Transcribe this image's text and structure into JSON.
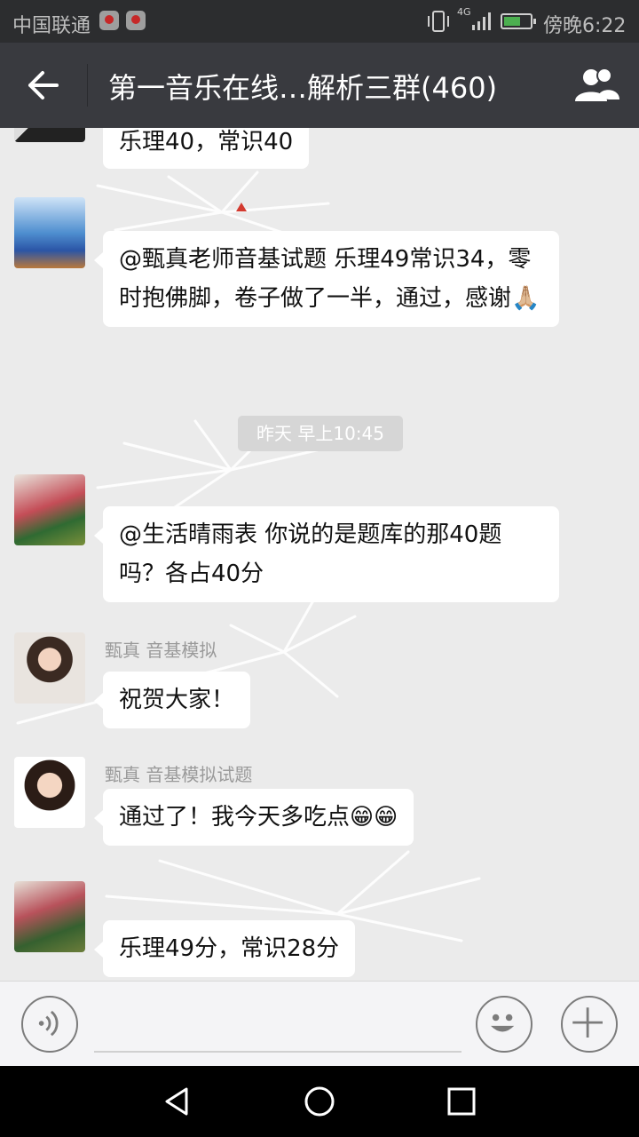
{
  "status_bar": {
    "carrier": "中国联通",
    "network_type": "4G",
    "time": "傍晚6:22",
    "icons": [
      "notification-icon",
      "notification-icon",
      "vibrate-icon",
      "signal-icon",
      "battery-icon"
    ]
  },
  "header": {
    "title": "第一音乐在线…解析三群(460)",
    "back_icon": "arrow-left-icon",
    "members_icon": "group-members-icon"
  },
  "messages": [
    {
      "sender": "",
      "text": "乐理40，常识40"
    },
    {
      "sender": "",
      "text": "@甄真老师音基试题 乐理49常识34，零时抱佛脚，卷子做了一半，通过，感谢🙏🏼"
    },
    {
      "sender": "",
      "text": "@生活晴雨表 你说的是题库的那40题吗？各占40分"
    },
    {
      "sender": "甄真 音基模拟",
      "text": "祝贺大家！"
    },
    {
      "sender": "甄真 音基模拟试题",
      "text": "通过了！我今天多吃点😁😁"
    },
    {
      "sender": "",
      "text": "乐理49分，常识28分"
    }
  ],
  "timestamp": "昨天 早上10:45",
  "input_bar": {
    "voice_icon": "voice-icon",
    "emoji_icon": "emoji-icon",
    "more_icon": "plus-icon"
  },
  "nav_bar": {
    "icons": [
      "back-triangle-icon",
      "home-circle-icon",
      "recents-square-icon"
    ]
  },
  "colors": {
    "status_bar": "#2c2d2f",
    "title_bar": "#393a3f",
    "chat_background": "#ebebeb",
    "bubble": "#ffffff",
    "sender_text": "#9a9a9a"
  }
}
